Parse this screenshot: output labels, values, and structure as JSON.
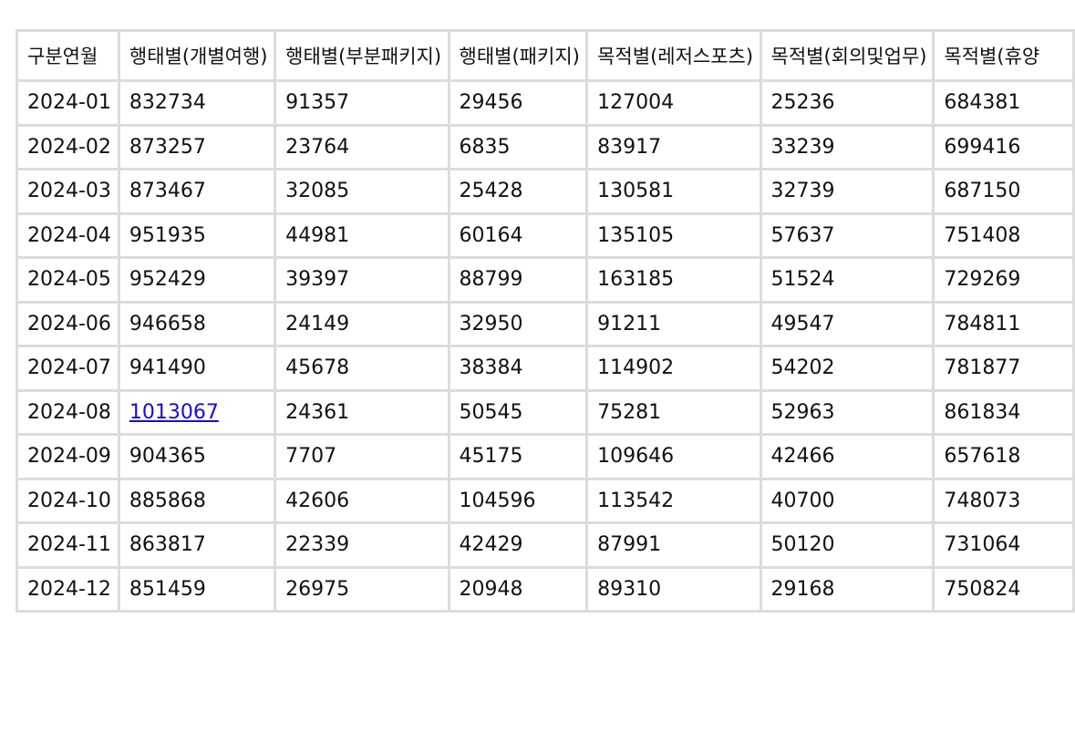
{
  "table": {
    "columns": [
      "구분연월",
      "행태별(개별여행)",
      "행태별(부분패키지)",
      "행태별(패키지)",
      "목적별(레저스포츠)",
      "목적별(회의및업무)",
      "목적별(휴양"
    ],
    "rows": [
      [
        "2024-01",
        "832734",
        "91357",
        "29456",
        "127004",
        "25236",
        "684381"
      ],
      [
        "2024-02",
        "873257",
        "23764",
        "6835",
        "83917",
        "33239",
        "699416"
      ],
      [
        "2024-03",
        "873467",
        "32085",
        "25428",
        "130581",
        "32739",
        "687150"
      ],
      [
        "2024-04",
        "951935",
        "44981",
        "60164",
        "135105",
        "57637",
        "751408"
      ],
      [
        "2024-05",
        "952429",
        "39397",
        "88799",
        "163185",
        "51524",
        "729269"
      ],
      [
        "2024-06",
        "946658",
        "24149",
        "32950",
        "91211",
        "49547",
        "784811"
      ],
      [
        "2024-07",
        "941490",
        "45678",
        "38384",
        "114902",
        "54202",
        "781877"
      ],
      [
        "2024-08",
        "1013067",
        "24361",
        "50545",
        "75281",
        "52963",
        "861834"
      ],
      [
        "2024-09",
        "904365",
        "7707",
        "45175",
        "109646",
        "42466",
        "657618"
      ],
      [
        "2024-10",
        "885868",
        "42606",
        "104596",
        "113542",
        "40700",
        "748073"
      ],
      [
        "2024-11",
        "863817",
        "22339",
        "42429",
        "87991",
        "50120",
        "731064"
      ],
      [
        "2024-12",
        "851459",
        "26975",
        "20948",
        "89310",
        "29168",
        "750824"
      ]
    ],
    "link_cell": {
      "row": 7,
      "col": 1
    }
  }
}
